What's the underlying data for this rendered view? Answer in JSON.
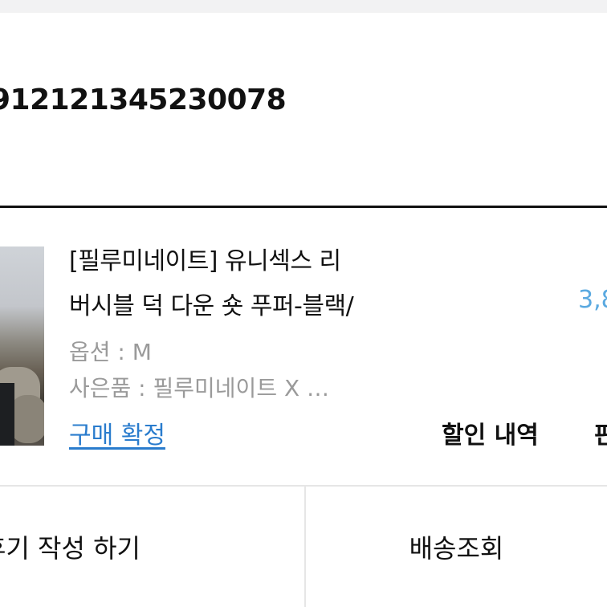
{
  "order": {
    "number": "912121345230078"
  },
  "product": {
    "title_line1": "[필루미네이트] 유니섹스 리",
    "title_line2": "버시블 덕 다운 숏 푸퍼-블랙/",
    "price": "3,8",
    "option": "옵션 : M",
    "gift": "사은품 : 필루미네이트 X …"
  },
  "actions": {
    "confirm_purchase": "구매 확정",
    "discount_details": "할인 내역",
    "extra": "판"
  },
  "bottom_buttons": {
    "write_review": "후기 작성 하기",
    "delivery_tracking": "배송조회"
  },
  "colors": {
    "price": "#5aa9e0",
    "link": "#2a7ccd",
    "muted_text": "#9a9a9a"
  }
}
